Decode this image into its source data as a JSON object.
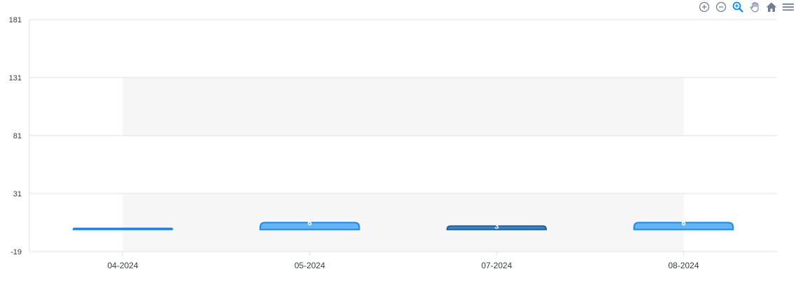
{
  "chart_data": {
    "type": "bar",
    "categories": [
      "04-2024",
      "05-2024",
      "07-2024",
      "08-2024"
    ],
    "values": [
      1,
      6,
      3,
      6
    ],
    "data_labels": [
      "",
      "6",
      "3",
      "6"
    ],
    "bar_colors": [
      "#1e88e5",
      "#64b5f6",
      "#3d85c6",
      "#64b5f6"
    ],
    "bar_strokes": [
      "#1e88e5",
      "#1e88e5",
      "#1f5f99",
      "#1e88e5"
    ],
    "yticks": [
      181,
      131,
      81,
      31,
      -19
    ],
    "ylim": [
      -19,
      181
    ],
    "title": "",
    "xlabel": "",
    "ylabel": "",
    "grid": true
  },
  "toolbar": {
    "icons": [
      "zoom-in-icon",
      "zoom-out-icon",
      "selection-zoom-icon",
      "pan-icon",
      "reset-home-icon",
      "menu-icon"
    ],
    "accent": "#008ffb",
    "icon_color": "#6e8192"
  }
}
